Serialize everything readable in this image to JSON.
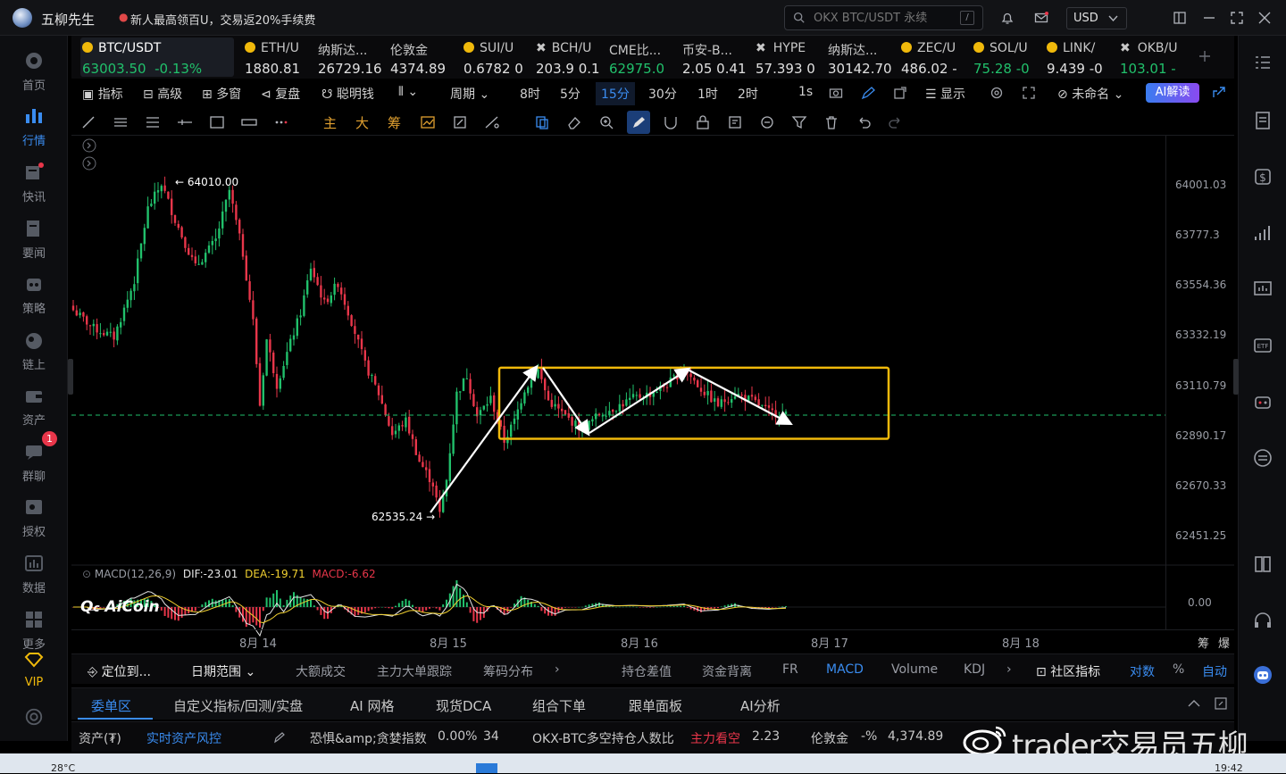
{
  "titlebar": {
    "app_name": "五柳先生",
    "promo": "新人最高领百U，交易返20%手续费",
    "search_placeholder": "OKX BTC/USDT 永续",
    "search_shortcut": "/",
    "currency": "USD"
  },
  "sidebar": {
    "items": [
      {
        "label": "首页",
        "icon": "home-icon"
      },
      {
        "label": "行情",
        "icon": "market-icon",
        "active": true
      },
      {
        "label": "快讯",
        "icon": "flash-news-icon"
      },
      {
        "label": "要闻",
        "icon": "news-icon"
      },
      {
        "label": "策略",
        "icon": "strategy-icon"
      },
      {
        "label": "链上",
        "icon": "onchain-icon"
      },
      {
        "label": "资产",
        "icon": "wallet-icon"
      },
      {
        "label": "群聊",
        "icon": "chat-icon"
      },
      {
        "label": "授权",
        "icon": "key-icon"
      },
      {
        "label": "数据",
        "icon": "data-icon"
      },
      {
        "label": "更多",
        "icon": "grid-icon"
      },
      {
        "label": "VIP",
        "icon": "vip-icon"
      }
    ],
    "chat_badge": "1"
  },
  "tickers": [
    {
      "name": "BTC/USDT",
      "price": "63003.50",
      "change": "-0.13%",
      "up": true
    },
    {
      "name": "ETH/U",
      "price": "1880.81"
    },
    {
      "name": "纳斯达...",
      "price": "26729.16"
    },
    {
      "name": "伦敦金",
      "price": "4374.89"
    },
    {
      "name": "SUI/U",
      "price": "0.6782 0"
    },
    {
      "name": "BCH/U",
      "price": "203.9 0.1"
    },
    {
      "name": "CME比...",
      "price": "62975.0",
      "green": true
    },
    {
      "name": "币安-B...",
      "price": "2.05 0.41"
    },
    {
      "name": "HYPE",
      "price": "57.393 0"
    },
    {
      "name": "纳斯达...",
      "price": "30142.70"
    },
    {
      "name": "ZEC/U",
      "price": "486.02 -"
    },
    {
      "name": "SOL/U",
      "price": "75.28 -0",
      "green": true
    },
    {
      "name": "LINK/",
      "price": "9.439 -0"
    },
    {
      "name": "OKB/U",
      "price": "103.01 -",
      "green": true
    }
  ],
  "toolbar": {
    "indicator": "指标",
    "advanced": "高级",
    "multi": "多窗",
    "replay": "复盘",
    "smart_money": "聪明钱",
    "period": "周期",
    "intervals": [
      "8时",
      "5分",
      "15分",
      "30分",
      "1时",
      "2时",
      "1s"
    ],
    "active_interval": "15分",
    "display": "显示",
    "unnamed": "未命名",
    "ai_button": "AI解读"
  },
  "draw_tools": {
    "main": "主",
    "big": "大",
    "chips": "筹"
  },
  "chart_data": {
    "type": "candlestick",
    "symbol": "BTC/USDT",
    "interval": "15分",
    "y_ticks": [
      64001.03,
      63777.3,
      63554.36,
      63332.19,
      63110.79,
      62890.17,
      62670.33,
      62451.25
    ],
    "x_ticks": [
      "8月 14",
      "8月 15",
      "8月 16",
      "8月 17",
      "8月 18"
    ],
    "annotations": {
      "high": "64010.00",
      "low": "62535.24"
    },
    "current_price": 62985,
    "box": {
      "price_top": 63195,
      "price_bottom": 62880
    },
    "price_path": [
      [
        0,
        63450
      ],
      [
        6,
        63370
      ],
      [
        12,
        63330
      ],
      [
        18,
        63580
      ],
      [
        22,
        63900
      ],
      [
        26,
        64010
      ],
      [
        30,
        63850
      ],
      [
        36,
        63640
      ],
      [
        42,
        63760
      ],
      [
        46,
        63980
      ],
      [
        50,
        63700
      ],
      [
        53,
        63400
      ],
      [
        55,
        63030
      ],
      [
        57,
        63320
      ],
      [
        60,
        63120
      ],
      [
        63,
        63260
      ],
      [
        67,
        63440
      ],
      [
        70,
        63640
      ],
      [
        74,
        63480
      ],
      [
        78,
        63570
      ],
      [
        82,
        63400
      ],
      [
        86,
        63210
      ],
      [
        90,
        63080
      ],
      [
        94,
        62900
      ],
      [
        98,
        62960
      ],
      [
        102,
        62780
      ],
      [
        106,
        62680
      ],
      [
        108,
        62545
      ],
      [
        110,
        62700
      ],
      [
        113,
        63080
      ],
      [
        116,
        63160
      ],
      [
        119,
        62980
      ],
      [
        123,
        63060
      ],
      [
        127,
        62870
      ],
      [
        130,
        62960
      ],
      [
        133,
        63100
      ],
      [
        137,
        63185
      ],
      [
        140,
        63050
      ],
      [
        145,
        62980
      ],
      [
        150,
        62920
      ],
      [
        155,
        62990
      ],
      [
        160,
        63020
      ],
      [
        165,
        63060
      ],
      [
        170,
        63080
      ],
      [
        175,
        63120
      ],
      [
        180,
        63190
      ],
      [
        185,
        63100
      ],
      [
        190,
        63030
      ],
      [
        195,
        63080
      ],
      [
        200,
        63050
      ],
      [
        205,
        63000
      ],
      [
        210,
        62985
      ]
    ],
    "macd": {
      "label": "MACD(12,26,9)",
      "dif": "DIF:-23.01",
      "dea": "DEA:-19.71",
      "macd": "MACD:-6.62",
      "zero": "0.00"
    }
  },
  "indicator_bar": {
    "locate": "定位到...",
    "date_range": "日期范围",
    "items": [
      "大额成交",
      "主力大单跟踪",
      "筹码分布",
      "持仓差值",
      "资金背离",
      "FR",
      "MACD",
      "Volume",
      "KDJ"
    ],
    "community": "社区指标",
    "log": "对数",
    "percent": "%",
    "auto": "自动"
  },
  "bottom_tabs": [
    "委单区",
    "自定义指标/回测/实盘",
    "AI 网格",
    "现货DCA",
    "组合下单",
    "跟单面板",
    "AI分析"
  ],
  "status": {
    "assets": "资产(₮)",
    "risk": "实时资产风控",
    "fear_label": "恐惧&amp;贪婪指数",
    "fear_value": "0.00%",
    "fear_num": "34",
    "okx_label": "OKX-BTC多空持仓人数比",
    "okx_signal": "主力看空",
    "okx_value": "2.23",
    "gold_label": "伦敦金",
    "gold_change": "-%",
    "gold_value": "4,374.89"
  },
  "chart_side": {
    "chips": "筹",
    "explode": "爆"
  },
  "logo_text": "AiCoin",
  "watermark": "trader交易员五柳",
  "taskbar": {
    "weather": "28°C",
    "clock": "19:42"
  }
}
